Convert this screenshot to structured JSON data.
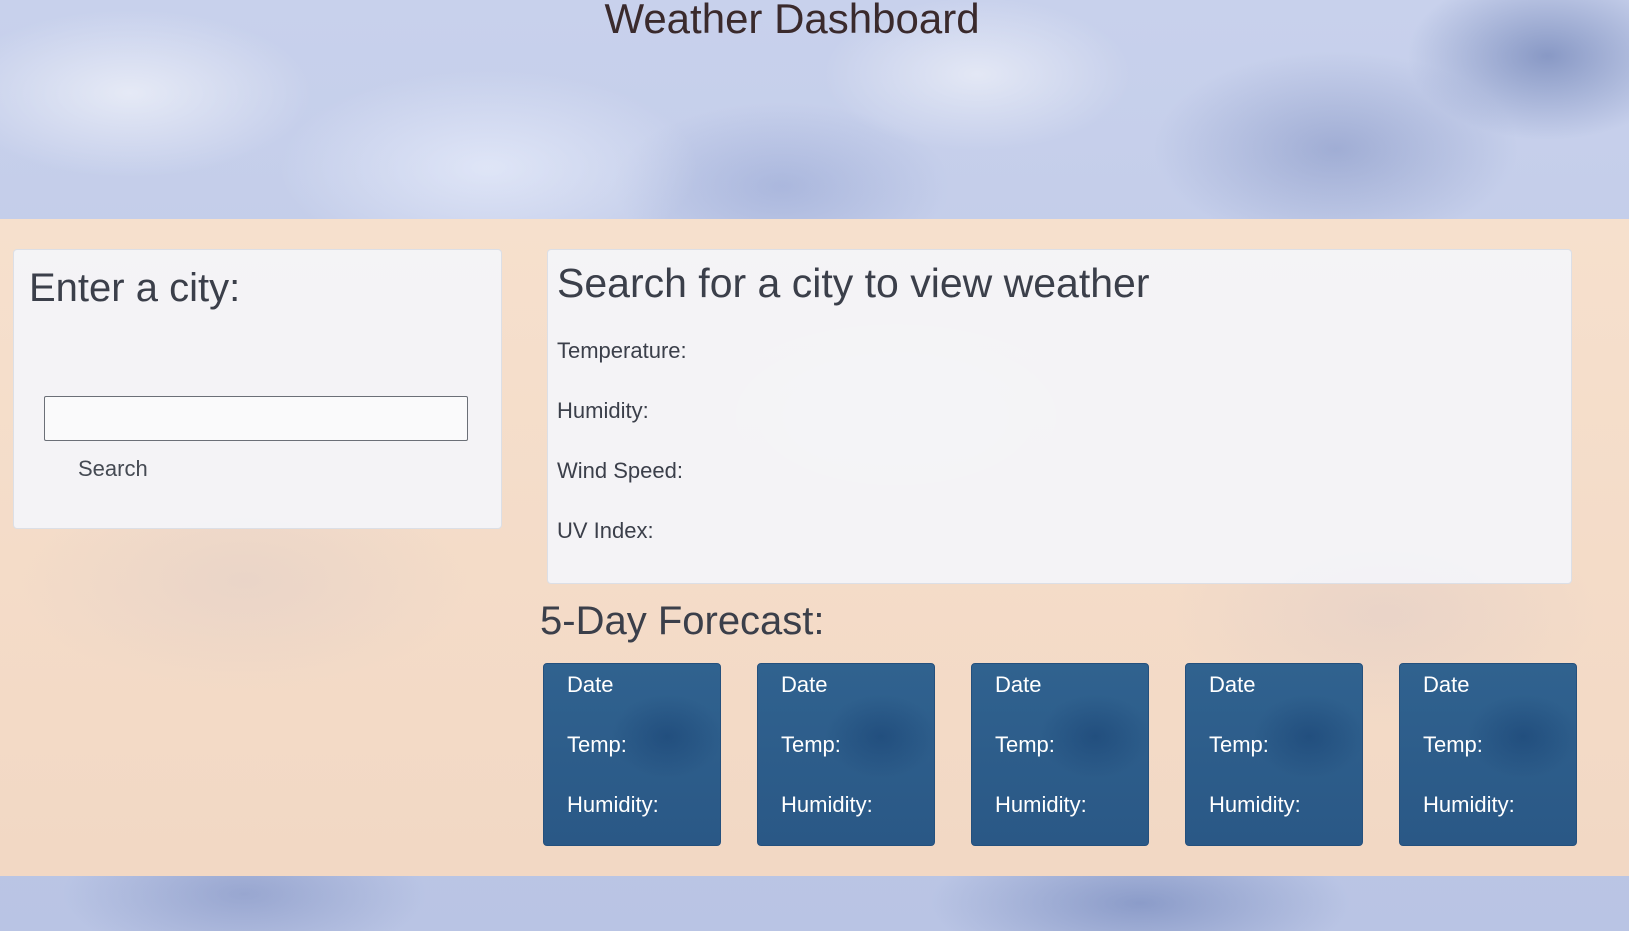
{
  "header": {
    "title": "Weather Dashboard"
  },
  "search_panel": {
    "heading": "Enter a city:",
    "input_value": "",
    "input_placeholder": "",
    "button_label": "Search"
  },
  "current_weather": {
    "heading": "Search for a city to view weather",
    "temperature_label": "Temperature:",
    "humidity_label": "Humidity:",
    "wind_speed_label": "Wind Speed:",
    "uv_index_label": "UV Index:"
  },
  "forecast": {
    "heading": "5-Day Forecast:",
    "cards": [
      {
        "date": "Date",
        "temp": "Temp:",
        "humidity": "Humidity:"
      },
      {
        "date": "Date",
        "temp": "Temp:",
        "humidity": "Humidity:"
      },
      {
        "date": "Date",
        "temp": "Temp:",
        "humidity": "Humidity:"
      },
      {
        "date": "Date",
        "temp": "Temp:",
        "humidity": "Humidity:"
      },
      {
        "date": "Date",
        "temp": "Temp:",
        "humidity": "Humidity:"
      }
    ]
  },
  "colors": {
    "main_background": "#f4dcc8",
    "card_background": "#2e5f8c",
    "panel_background": "#f4f6fc",
    "title_text": "#3a2a2c"
  }
}
